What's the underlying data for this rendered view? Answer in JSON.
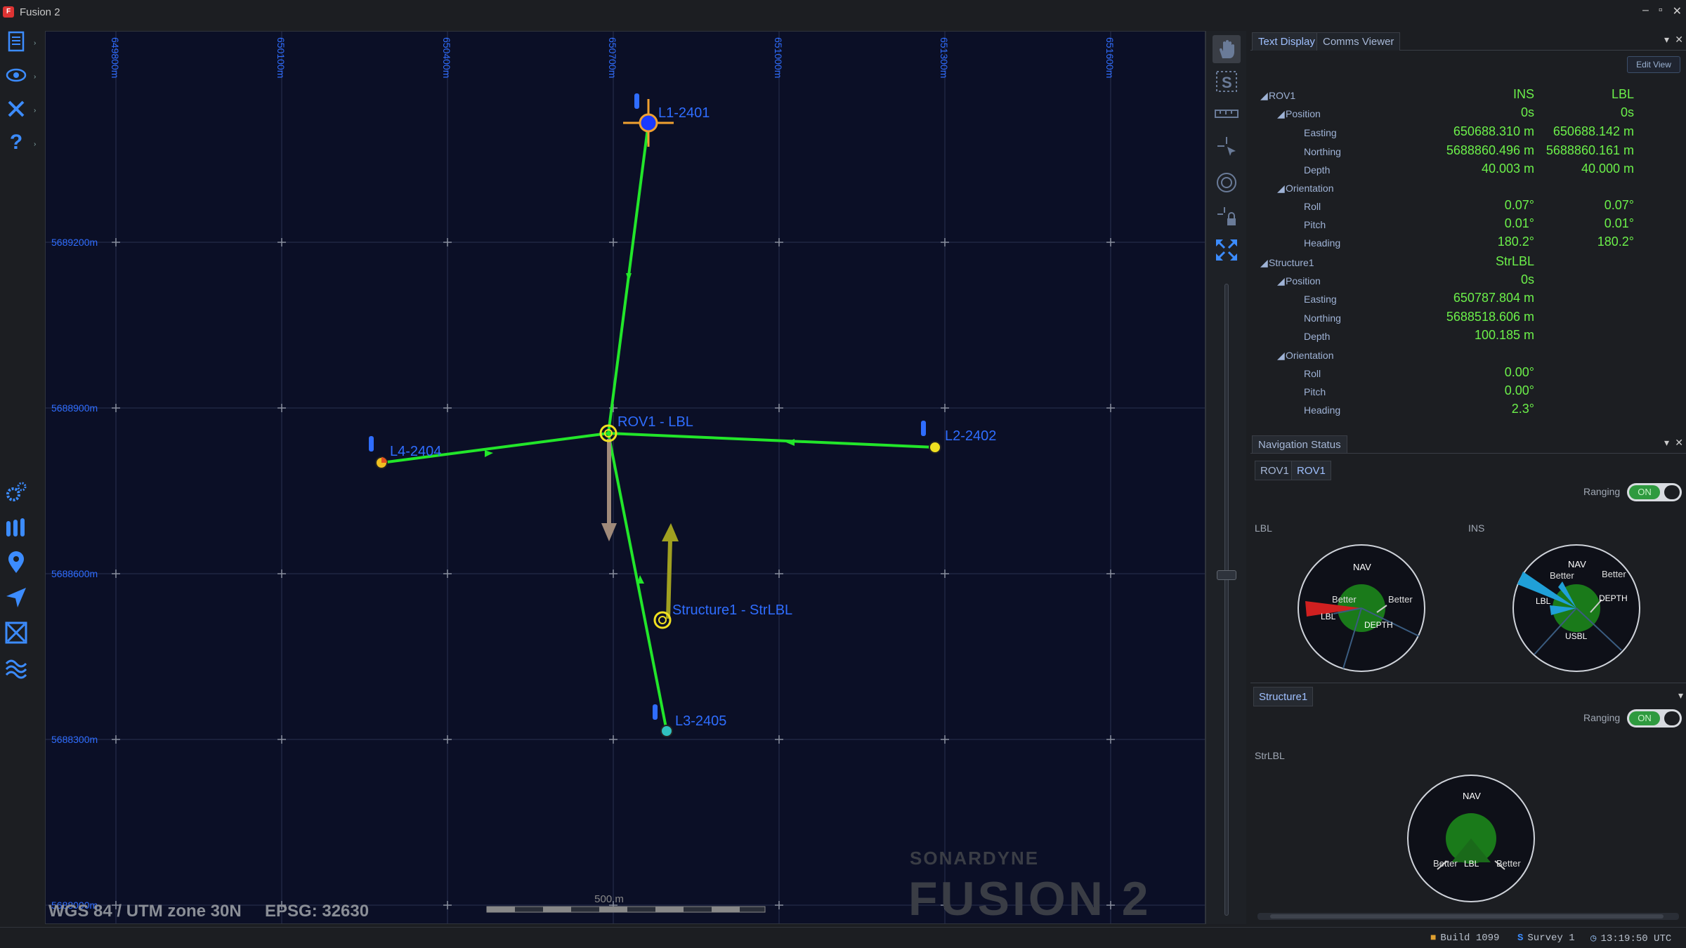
{
  "window": {
    "title": "Fusion 2",
    "controls": [
      "–",
      "▫",
      "✕"
    ]
  },
  "leftbar": {
    "top_icons": [
      "document-icon",
      "eye-icon",
      "tools-icon",
      "help-icon"
    ],
    "bottom_icons": [
      "settings-gears-icon",
      "beacons-icon",
      "location-pin-icon",
      "navigate-arrow-icon",
      "network-icon",
      "waves-icon"
    ]
  },
  "map": {
    "x_ticks": [
      "649800m",
      "650100m",
      "650400m",
      "650700m",
      "651000m",
      "651300m",
      "651600m"
    ],
    "y_ticks": [
      "5689200m",
      "5688900m",
      "5688600m",
      "5688300m",
      "5688000m"
    ],
    "crs_label": "WGS 84 / UTM zone 30N",
    "epsg_label": "EPSG: 32630",
    "scale_label": "500 m",
    "watermark_brand": "SONARDYNE",
    "watermark_product": "FUSION 2",
    "labels": {
      "l1": "L1-2401",
      "l2": "L2-2402",
      "l3": "L3-2405",
      "l4": "L4-2404",
      "rov": "ROV1 - LBL",
      "structure": "Structure1 - StrLBL"
    },
    "colors": {
      "link": "#22e62a",
      "label": "#2f6dff",
      "grid": "#2a3050",
      "tick_label": "#2f6dff"
    }
  },
  "toolstrip": {
    "tools": [
      "pan-hand-icon",
      "select-s-icon",
      "ruler-icon",
      "pointer-target-icon",
      "circle-icon",
      "lock-pointer-icon",
      "fit-extents-icon"
    ]
  },
  "text_display": {
    "tabs": [
      "Text Display",
      "Comms Viewer"
    ],
    "edit_view": "Edit View",
    "col_ins": "INS",
    "col_lbl": "LBL",
    "rov": {
      "name": "ROV1",
      "position_label": "Position",
      "position_age_ins": "0s",
      "position_age_lbl": "0s",
      "easting_label": "Easting",
      "easting_ins": "650688.310 m",
      "easting_lbl": "650688.142 m",
      "northing_label": "Northing",
      "northing_ins": "5688860.496 m",
      "northing_lbl": "5688860.161 m",
      "depth_label": "Depth",
      "depth_ins": "40.003 m",
      "depth_lbl": "40.000 m",
      "orientation_label": "Orientation",
      "roll_label": "Roll",
      "roll_ins": "0.07°",
      "roll_lbl": "0.07°",
      "pitch_label": "Pitch",
      "pitch_ins": "0.01°",
      "pitch_lbl": "0.01°",
      "heading_label": "Heading",
      "heading_ins": "180.2°",
      "heading_lbl": "180.2°"
    },
    "structure": {
      "name": "Structure1",
      "col": "StrLBL",
      "position_label": "Position",
      "position_age": "0s",
      "easting_label": "Easting",
      "easting": "650787.804 m",
      "northing_label": "Northing",
      "northing": "5688518.606 m",
      "depth_label": "Depth",
      "depth": "100.185 m",
      "orientation_label": "Orientation",
      "roll_label": "Roll",
      "roll": "0.00°",
      "pitch_label": "Pitch",
      "pitch": "0.00°",
      "heading_label": "Heading",
      "heading": "2.3°"
    }
  },
  "nav_status": {
    "title": "Navigation Status",
    "rov_tabs": [
      "ROV1",
      "ROV1"
    ],
    "ranging_label": "Ranging",
    "ranging_value": "ON",
    "lbl_label": "LBL",
    "ins_label": "INS",
    "dial_lbl": {
      "nav": "NAV",
      "better_left": "Better",
      "better_right": "Better",
      "lbl": "LBL",
      "depth": "DEPTH"
    },
    "dial_ins": {
      "nav": "NAV",
      "better_left": "Better",
      "better_right": "Better",
      "lbl": "LBL",
      "depth": "DEPTH",
      "usbl": "USBL"
    },
    "structure_tab": "Structure1",
    "structure_ranging_label": "Ranging",
    "structure_ranging_value": "ON",
    "strlbl_label": "StrLBL",
    "dial_str": {
      "nav": "NAV",
      "better_left": "Better",
      "better_right": "Better",
      "lbl": "LBL"
    }
  },
  "statusbar": {
    "build": "Build 1099",
    "survey": "Survey 1",
    "time": "13:19:50 UTC"
  }
}
